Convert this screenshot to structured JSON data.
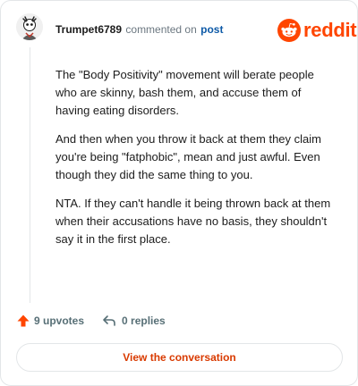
{
  "header": {
    "username": "Trumpet6789",
    "action_text": "commented on",
    "post_link": "post",
    "logo_wordmark": "reddit",
    "logo_icon": "reddit-snoo-icon",
    "avatar_icon": "user-avatar-icon"
  },
  "comment": {
    "paragraphs": [
      "The \"Body Positivity\" movement will berate people who are skinny, bash them, and accuse them of having eating disorders.",
      "And then when you throw it back at them they claim you're being \"fatphobic\", mean and just awful. Even though they did the same thing to you.",
      "NTA. If they can't handle it being thrown back at them when their accusations have no basis, they shouldn't say it in the first place."
    ]
  },
  "footer": {
    "upvotes_label": "9 upvotes",
    "upvote_icon": "upvote-arrow-icon",
    "replies_label": "0 replies",
    "reply_icon": "reply-arrow-icon"
  },
  "cta": {
    "label": "View the conversation"
  },
  "colors": {
    "brand": "#ff4500",
    "link": "#0e5aa7",
    "cta_text": "#d93a00",
    "muted": "#576f76",
    "border": "#e3e6e8"
  }
}
